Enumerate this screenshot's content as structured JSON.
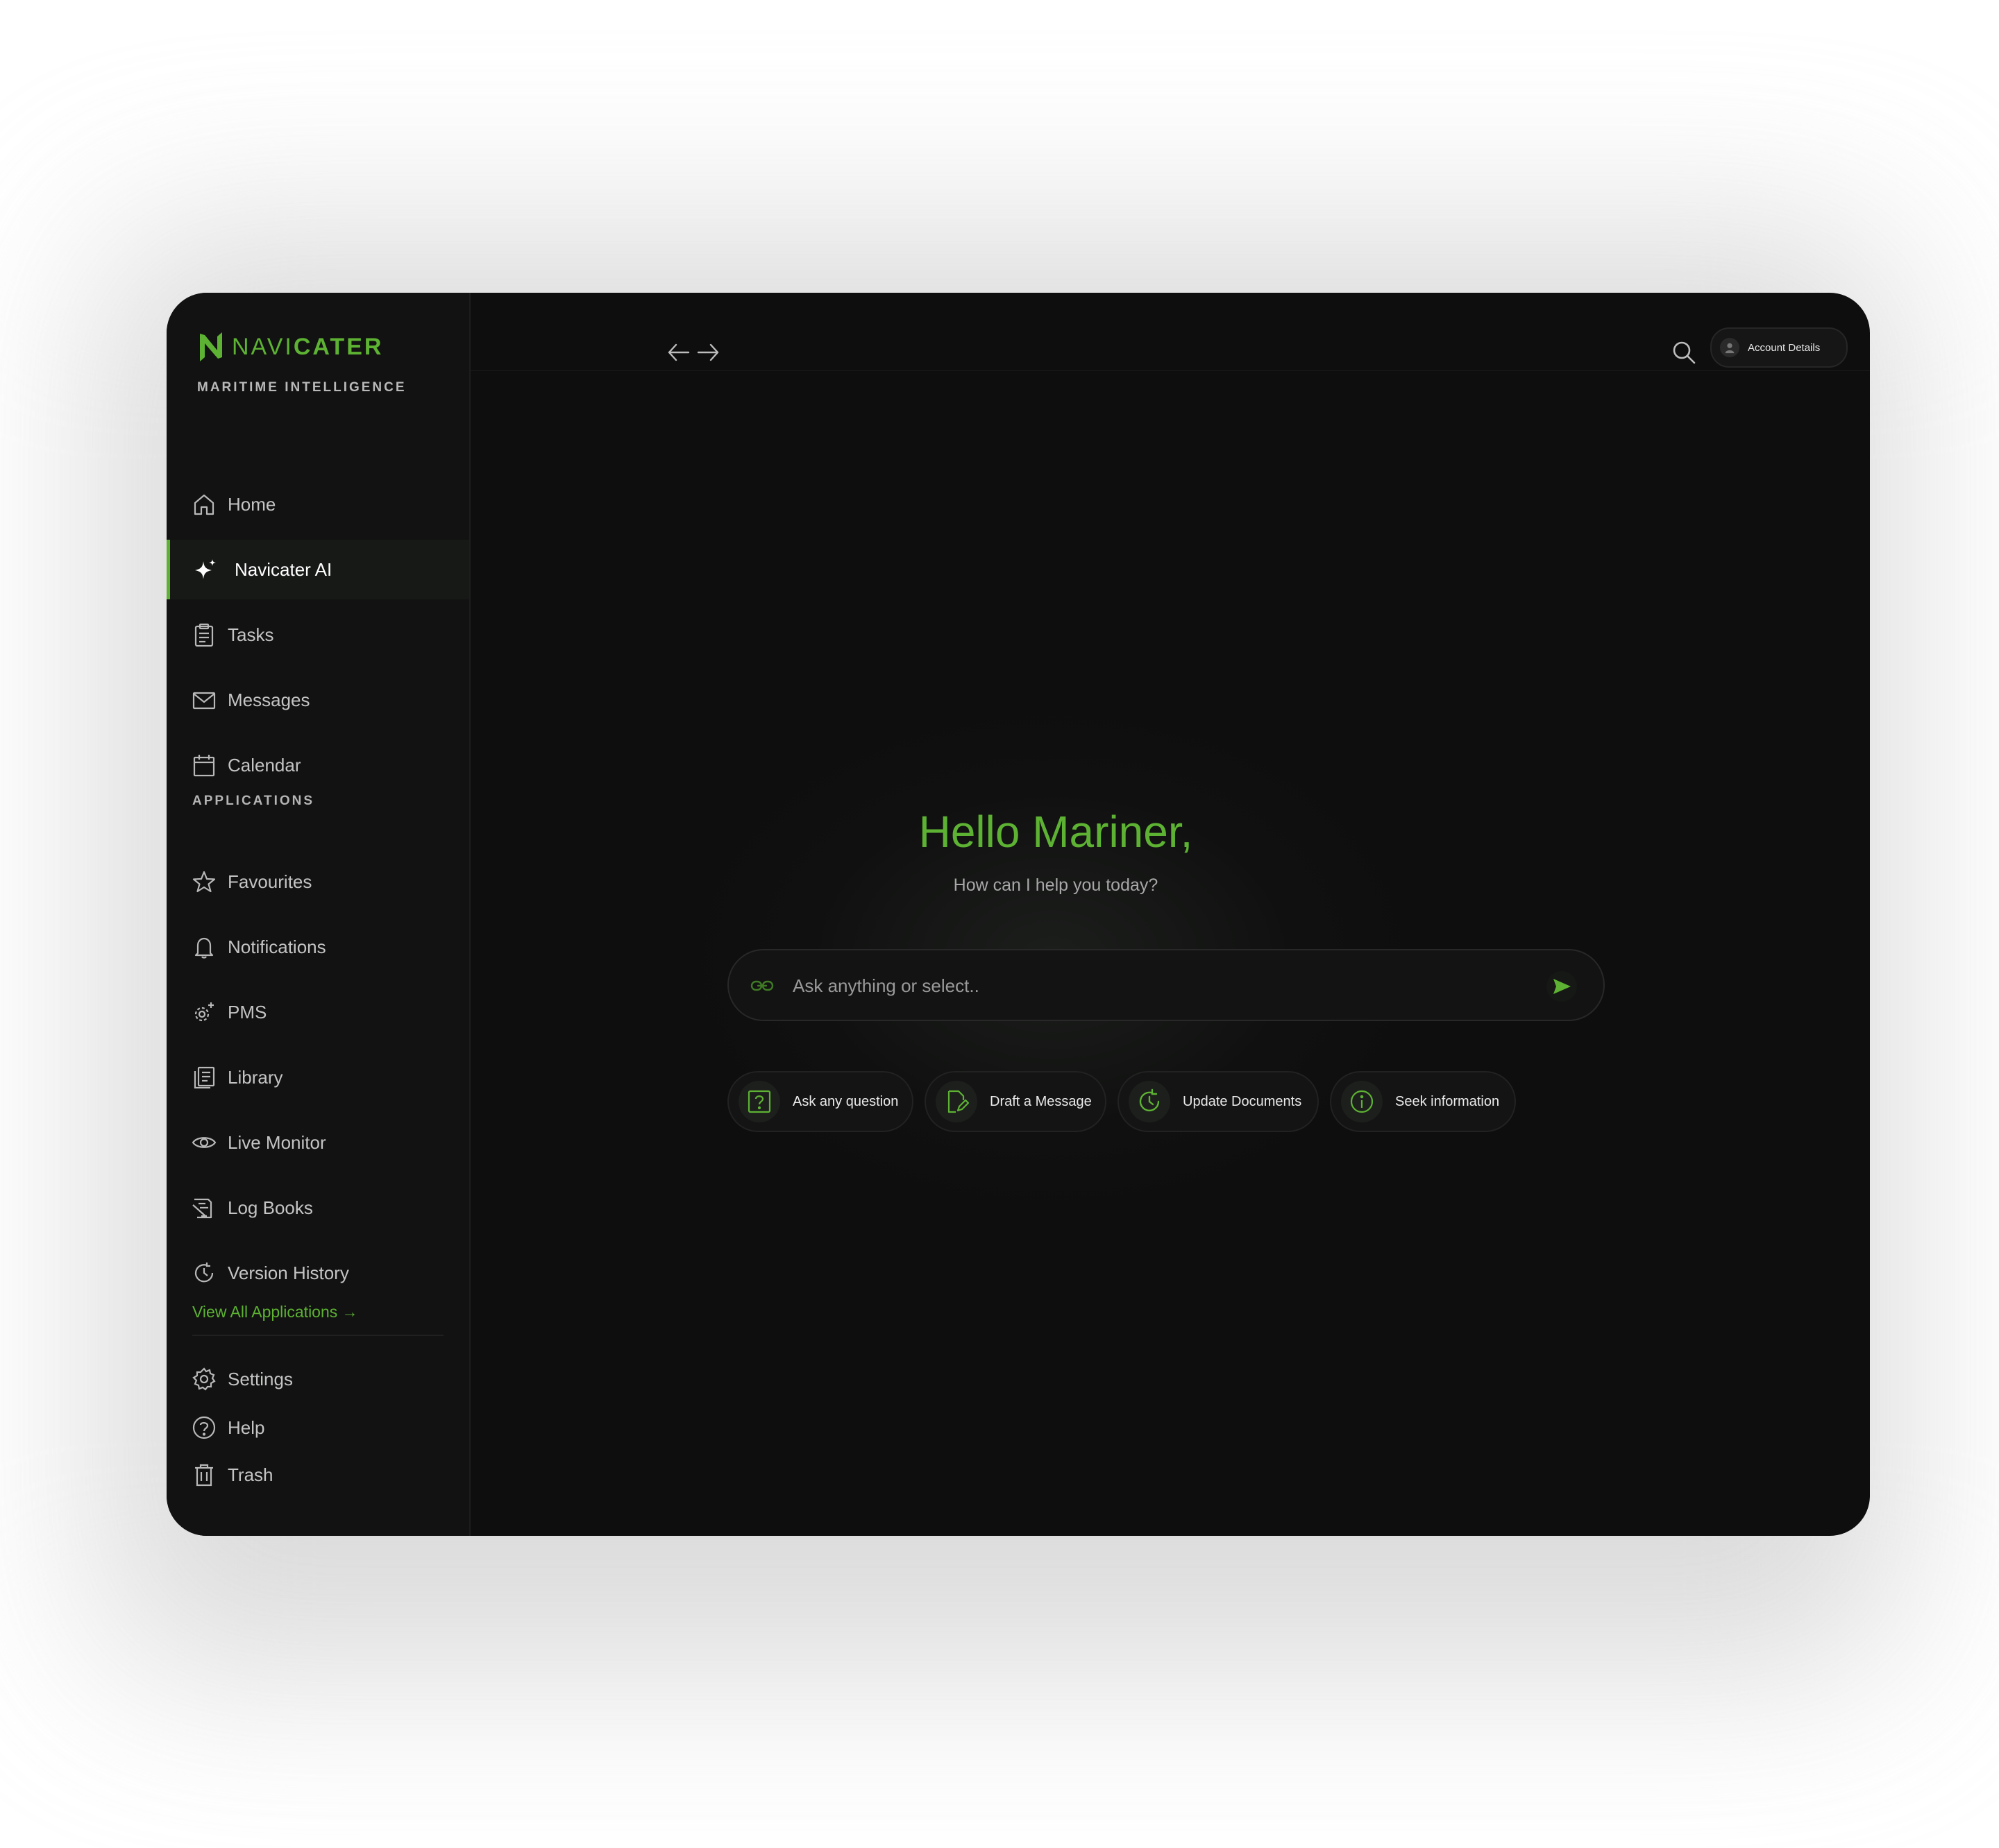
{
  "brand": {
    "name_part1": "NAVI",
    "name_part2": "CATER",
    "tagline": "MARITIME INTELLIGENCE",
    "accent_color": "#5db233"
  },
  "sidebar": {
    "items": [
      {
        "label": "Home",
        "icon": "home-icon"
      },
      {
        "label": "Navicater AI",
        "icon": "sparkle-icon",
        "active": true
      },
      {
        "label": "Tasks",
        "icon": "clipboard-icon"
      },
      {
        "label": "Messages",
        "icon": "mail-icon"
      },
      {
        "label": "Calendar",
        "icon": "calendar-icon"
      }
    ],
    "applications_label": "APPLICATIONS",
    "applications": [
      {
        "label": "Favourites",
        "icon": "star-icon"
      },
      {
        "label": "Notifications",
        "icon": "bell-icon"
      },
      {
        "label": "PMS",
        "icon": "gears-icon"
      },
      {
        "label": "Library",
        "icon": "library-icon"
      },
      {
        "label": "Live Monitor",
        "icon": "eye-icon"
      },
      {
        "label": "Log Books",
        "icon": "logbook-icon"
      },
      {
        "label": "Version History",
        "icon": "history-icon"
      }
    ],
    "view_all": "View All Applications →",
    "footer": [
      {
        "label": "Settings",
        "icon": "gear-icon"
      },
      {
        "label": "Help",
        "icon": "help-icon"
      },
      {
        "label": "Trash",
        "icon": "trash-icon"
      }
    ]
  },
  "topbar": {
    "account_label": "Account Details"
  },
  "main": {
    "greeting": "Hello Mariner,",
    "subtitle": "How can I help you today?",
    "input_placeholder": "Ask anything or select..",
    "chips": [
      {
        "label": "Ask any question",
        "icon": "question-icon"
      },
      {
        "label": "Draft a Message",
        "icon": "draft-icon"
      },
      {
        "label": "Update Documents",
        "icon": "refresh-icon"
      },
      {
        "label": "Seek information",
        "icon": "info-icon"
      }
    ]
  }
}
